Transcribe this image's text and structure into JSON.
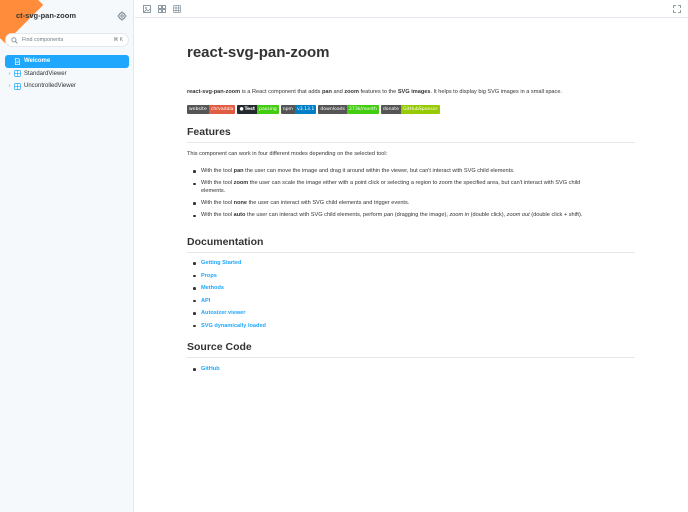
{
  "sidebar": {
    "brand": "react-svg-pan-zoom",
    "brand_visible": "ct-svg-pan-zoom",
    "search_placeholder": "Find components",
    "search_shortcut": "⌘ K",
    "items": [
      {
        "label": "Welcome",
        "type": "story",
        "active": true
      },
      {
        "label": "StandardViewer",
        "type": "component",
        "active": false
      },
      {
        "label": "UncontrolledViewer",
        "type": "component",
        "active": false
      }
    ]
  },
  "doc": {
    "title": "react-svg-pan-zoom",
    "intro": {
      "p1": "react-svg-pan-zoom",
      "p2": " is a React component that adds ",
      "p3": "pan",
      "p4": " and ",
      "p5": "zoom",
      "p6": " features to the ",
      "p7": "SVG images",
      "p8": ". It helps to display big SVG images in a small space."
    },
    "badges": [
      {
        "left": "website",
        "right": "chrvadala",
        "color": "#e05d44"
      },
      {
        "left": "Test",
        "right": "passing",
        "color": "#4c1"
      },
      {
        "left": "npm",
        "right": "v3.13.1",
        "color": "#007ec6"
      },
      {
        "left": "downloads",
        "right": "273k/month",
        "color": "#4c1"
      },
      {
        "left": "donate",
        "right": "GitHubSponsor",
        "color": "#97ca00"
      }
    ],
    "features": {
      "heading": "Features",
      "lead": "This component can work in four different modes depending on the selected tool:",
      "items": [
        {
          "pre": "With the tool ",
          "tool": "pan",
          "post": " the user can move the image and drag it around within the viewer, but can't interact with SVG child elements."
        },
        {
          "pre": "With the tool ",
          "tool": "zoom",
          "post": " the user can scale the image either with a point click or selecting a region to zoom the specified area, but can't interact with SVG child",
          "post2": "elements."
        },
        {
          "pre": "With the tool ",
          "tool": "none",
          "post": " the user can interact with SVG child elements and trigger events."
        },
        {
          "pre": "With the tool ",
          "tool": "auto",
          "post": " the user can interact with SVG child elements, perform ",
          "i1": "pan",
          "m1": " (dragging the image), ",
          "i2": "zoom in",
          "m2": " (double click), ",
          "i3": "zoom out",
          "m3": " (double click + shift)."
        }
      ]
    },
    "documentation": {
      "heading": "Documentation",
      "links": [
        "Getting Started",
        "Props",
        "Methods",
        "API",
        "Autosizer viewer",
        "SVG dynamically loaded"
      ]
    },
    "source": {
      "heading": "Source Code",
      "links": [
        "GitHub"
      ]
    }
  },
  "colors": {
    "accent": "#1ea7fd",
    "ribbon": "#ff8c3a"
  }
}
